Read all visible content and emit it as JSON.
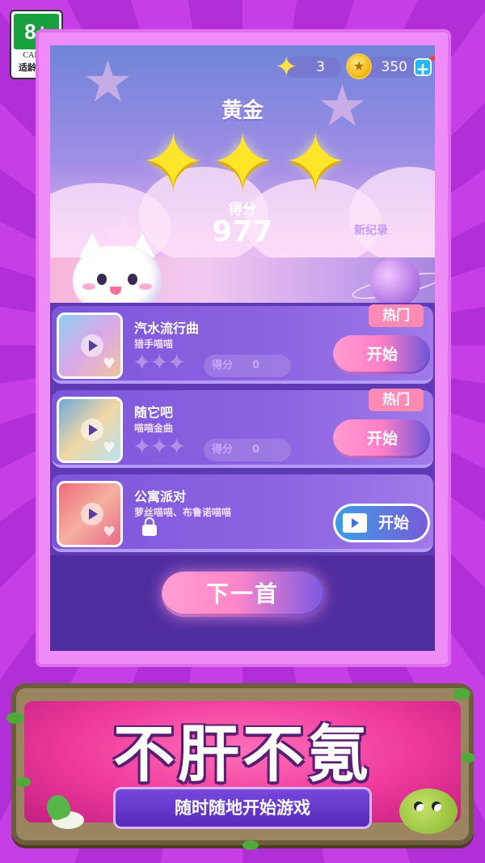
{
  "age_rating": {
    "age": "8+",
    "org": "CADPA",
    "tip": "适龄提示"
  },
  "currency": {
    "stars": "3",
    "coins": "350",
    "add_symbol": "+"
  },
  "result": {
    "rank": "黄金",
    "stars_earned": 3,
    "score_label": "得分",
    "score_value": "977",
    "new_record": "新纪录"
  },
  "songs": [
    {
      "title": "汽水流行曲",
      "artist": "猎手喵喵",
      "score_label": "得分",
      "score": "0",
      "hot": "热门",
      "start": "开始",
      "locked": false
    },
    {
      "title": "随它吧",
      "artist": "喵喵金曲",
      "score_label": "得分",
      "score": "0",
      "hot": "热门",
      "start": "开始",
      "locked": false
    },
    {
      "title": "公寓派对",
      "artist": "萝丝喵喵、布鲁诺喵喵",
      "start": "开始",
      "locked": true
    }
  ],
  "next_button": "下一首",
  "promo": {
    "slogan": "不肝不氪",
    "subtitle": "随时随地开始游戏"
  },
  "colors": {
    "accent_pink": "#ff87c9",
    "accent_purple": "#7f58e0",
    "star_gold": "#ffe52a",
    "rating_green": "#17a03d"
  }
}
